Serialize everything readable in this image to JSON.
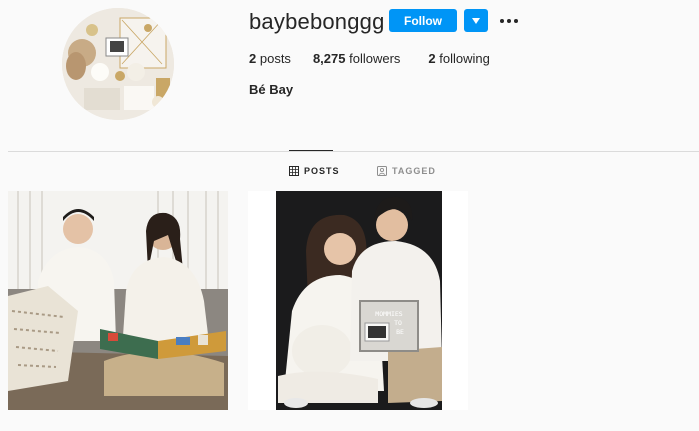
{
  "profile": {
    "username": "baybebonggg",
    "full_name": "Bé Bay",
    "follow_label": "Follow",
    "avatar_icon": "profile-photo",
    "dropdown_icon": "caret-down-icon",
    "more_icon": "more-horizontal-icon"
  },
  "stats": [
    {
      "value": "2",
      "label": "posts"
    },
    {
      "value": "8,275",
      "label": "followers"
    },
    {
      "value": "2",
      "label": "following"
    }
  ],
  "tabs": {
    "posts": "POSTS",
    "tagged": "TAGGED"
  },
  "posts": [
    {
      "icon": "photo-couple-reading-book"
    },
    {
      "icon": "photo-couple-ultrasound-board"
    }
  ],
  "board_text": [
    "MOMMIES",
    "TO",
    "BE"
  ],
  "colors": {
    "accent": "#0095f6",
    "text": "#262626",
    "muted": "#8e8e8e",
    "divider": "#dbdbdb",
    "background": "#fafafa"
  }
}
